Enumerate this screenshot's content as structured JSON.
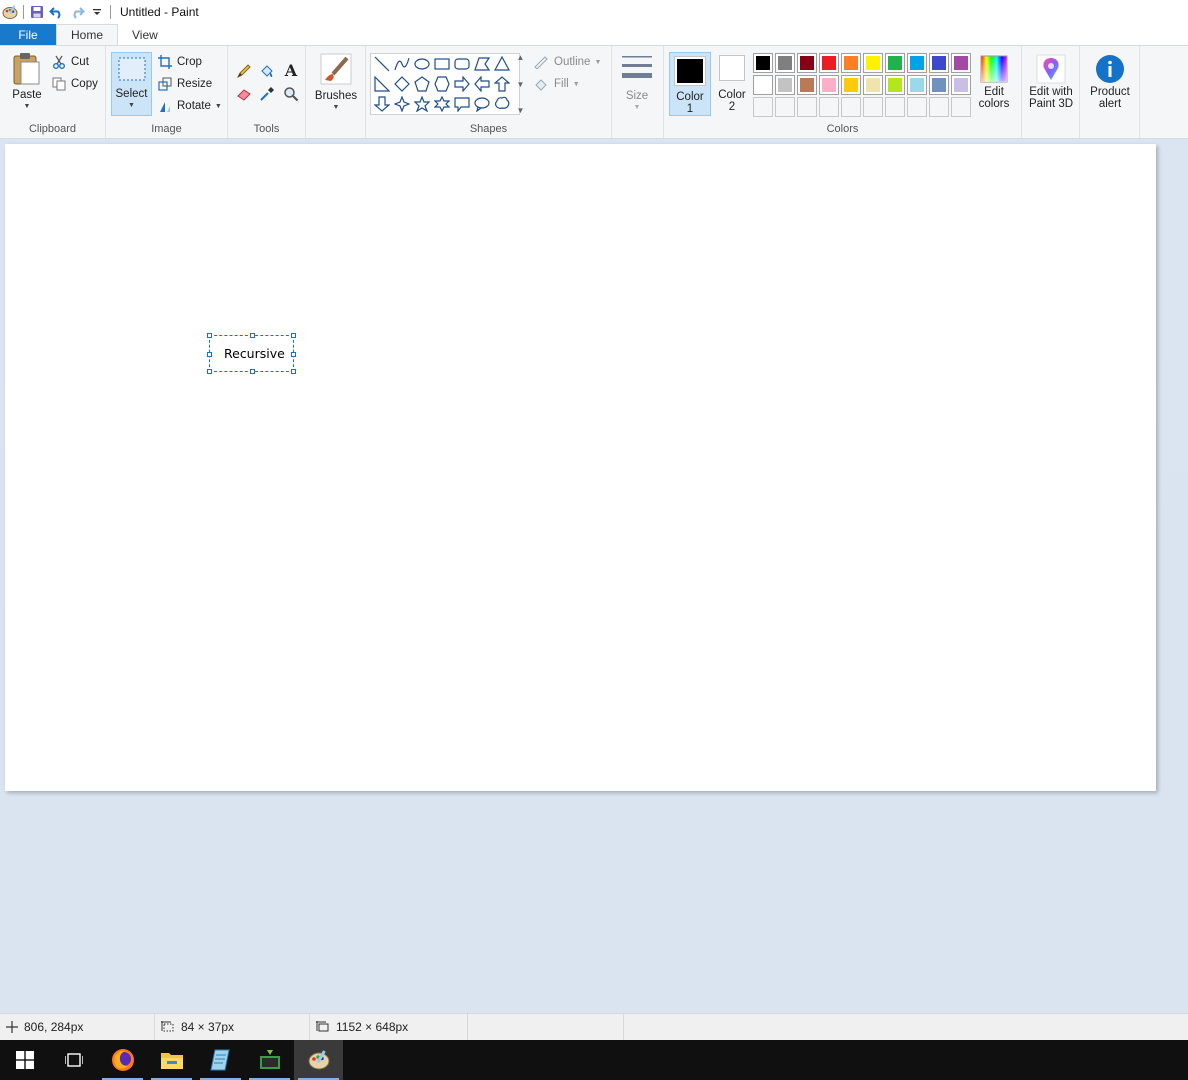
{
  "window": {
    "title": "Untitled - Paint"
  },
  "tabs": [
    {
      "label": "File"
    },
    {
      "label": "Home"
    },
    {
      "label": "View"
    }
  ],
  "ribbon": {
    "clipboard": {
      "group_label": "Clipboard",
      "paste": "Paste",
      "cut": "Cut",
      "copy": "Copy"
    },
    "image": {
      "group_label": "Image",
      "select": "Select",
      "crop": "Crop",
      "resize": "Resize",
      "rotate": "Rotate"
    },
    "tools": {
      "group_label": "Tools"
    },
    "brushes": {
      "label": "Brushes"
    },
    "shapes": {
      "group_label": "Shapes",
      "outline": "Outline",
      "fill": "Fill"
    },
    "size": {
      "label": "Size"
    },
    "colors": {
      "group_label": "Colors",
      "color1_line1": "Color",
      "color1_line2": "1",
      "color2_line1": "Color",
      "color2_line2": "2",
      "color1_value": "#000000",
      "color2_value": "#ffffff",
      "edit_colors_line1": "Edit",
      "edit_colors_line2": "colors",
      "palette_row1": [
        "#000000",
        "#7f7f7f",
        "#880015",
        "#ed1c24",
        "#ff7f27",
        "#fff200",
        "#22b14c",
        "#00a2e8",
        "#3f48cc",
        "#a349a4"
      ],
      "palette_row2": [
        "#ffffff",
        "#c3c3c3",
        "#b97a57",
        "#ffaec9",
        "#ffc90e",
        "#efe4b0",
        "#b5e61d",
        "#99d9ea",
        "#7092be",
        "#c8bfe7"
      ]
    },
    "paint3d": {
      "line1": "Edit with",
      "line2": "Paint 3D"
    },
    "product_alert": {
      "line1": "Product",
      "line2": "alert"
    }
  },
  "canvas": {
    "text_box": "Recursive"
  },
  "status": {
    "cursor_pos": "806, 284px",
    "selection_size": "84 × 37px",
    "image_size": "1152 × 648px"
  },
  "taskbar": {
    "apps": [
      "start-icon",
      "task-view-icon",
      "firefox-icon",
      "file-explorer-icon",
      "notepad-icon",
      "app-icon",
      "paint-icon"
    ]
  }
}
